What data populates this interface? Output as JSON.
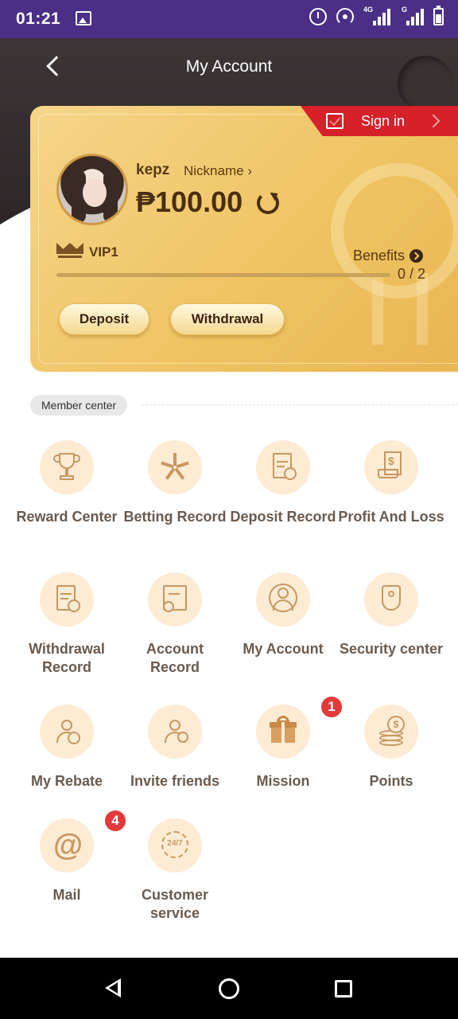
{
  "status_bar": {
    "time": "01:21",
    "network_label_1": "4G",
    "network_label_2": "G"
  },
  "header": {
    "title": "My Account"
  },
  "card": {
    "signin_label": "Sign in",
    "username": "kepz",
    "nickname_label": "Nickname",
    "balance": "₱100.00",
    "vip_level": "VIP1",
    "benefits_label": "Benefits",
    "progress_text": "0 / 2",
    "progress_fraction": 0,
    "deposit_label": "Deposit",
    "withdrawal_label": "Withdrawal"
  },
  "member_center": {
    "section_label": "Member center",
    "items": [
      {
        "label": "Reward Center",
        "icon": "trophy-icon"
      },
      {
        "label": "Betting Record",
        "icon": "betting-icon"
      },
      {
        "label": "Deposit Record",
        "icon": "deposit-record-icon"
      },
      {
        "label": "Profit And Loss",
        "icon": "receipt-icon"
      },
      {
        "label": "Withdrawal Record",
        "icon": "withdrawal-record-icon"
      },
      {
        "label": "Account Record",
        "icon": "account-record-icon"
      },
      {
        "label": "My Account",
        "icon": "user-circle-icon"
      },
      {
        "label": "Security center",
        "icon": "shield-icon"
      },
      {
        "label": "My Rebate",
        "icon": "rebate-icon"
      },
      {
        "label": "Invite friends",
        "icon": "invite-friend-icon"
      },
      {
        "label": "Mission",
        "icon": "gift-icon",
        "badge": "1"
      },
      {
        "label": "Points",
        "icon": "coins-icon"
      },
      {
        "label": "Mail",
        "icon": "at-icon",
        "badge": "4"
      },
      {
        "label": "Customer service",
        "icon": "customer-service-icon",
        "icon_text": "24/7"
      }
    ]
  },
  "colors": {
    "status_bar": "#4b2f86",
    "card_gold": "#efc463",
    "signin_red": "#d6202a",
    "badge_red": "#e23a3a",
    "icon_bg": "#fdebd4"
  }
}
